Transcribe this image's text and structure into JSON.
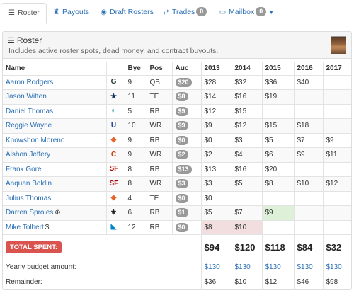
{
  "tabs": [
    {
      "label": "Roster",
      "icon": "list-icon"
    },
    {
      "label": "Payouts",
      "icon": "trophy-icon"
    },
    {
      "label": "Draft Rosters",
      "icon": "eye-icon"
    },
    {
      "label": "Trades",
      "icon": "exchange-icon",
      "badge": "0"
    },
    {
      "label": "Mailbox",
      "icon": "inbox-icon",
      "badge": "0"
    }
  ],
  "panel": {
    "title": "Roster",
    "subtitle": "Includes active roster spots, dead money, and contract buyouts."
  },
  "table": {
    "headers": [
      "Name",
      "",
      "Bye",
      "Pos",
      "Auc",
      "2013",
      "2014",
      "2015",
      "2016",
      "2017"
    ],
    "rows": [
      {
        "name": "Aaron Rodgers",
        "team": "GB",
        "bye": "9",
        "pos": "QB",
        "auc": "$20",
        "y2013": "$28",
        "y2014": "$32",
        "y2015": "$36",
        "y2016": "$40",
        "y2017": ""
      },
      {
        "name": "Jason Witten",
        "team": "DAL",
        "bye": "11",
        "pos": "TE",
        "auc": "$8",
        "y2013": "$14",
        "y2014": "$16",
        "y2015": "$19",
        "y2016": "",
        "y2017": ""
      },
      {
        "name": "Daniel Thomas",
        "team": "MIA",
        "bye": "5",
        "pos": "RB",
        "auc": "$9",
        "y2013": "$12",
        "y2014": "$15",
        "y2015": "",
        "y2016": "",
        "y2017": ""
      },
      {
        "name": "Reggie Wayne",
        "team": "IND",
        "bye": "10",
        "pos": "WR",
        "auc": "$9",
        "y2013": "$9",
        "y2014": "$12",
        "y2015": "$15",
        "y2016": "$18",
        "y2017": ""
      },
      {
        "name": "Knowshon Moreno",
        "team": "DEN",
        "bye": "9",
        "pos": "RB",
        "auc": "$0",
        "y2013": "$0",
        "y2014": "$3",
        "y2015": "$5",
        "y2016": "$7",
        "y2017": "$9"
      },
      {
        "name": "Alshon Jeffery",
        "team": "CHI",
        "bye": "9",
        "pos": "WR",
        "auc": "$2",
        "y2013": "$2",
        "y2014": "$4",
        "y2015": "$6",
        "y2016": "$9",
        "y2017": "$11"
      },
      {
        "name": "Frank Gore",
        "team": "SF",
        "bye": "8",
        "pos": "RB",
        "auc": "$13",
        "y2013": "$13",
        "y2014": "$16",
        "y2015": "$20",
        "y2016": "",
        "y2017": ""
      },
      {
        "name": "Anquan Boldin",
        "team": "SF",
        "bye": "8",
        "pos": "WR",
        "auc": "$3",
        "y2013": "$3",
        "y2014": "$5",
        "y2015": "$8",
        "y2016": "$10",
        "y2017": "$12"
      },
      {
        "name": "Julius Thomas",
        "team": "DEN",
        "bye": "4",
        "pos": "TE",
        "auc": "$0",
        "y2013": "$0",
        "y2014": "",
        "y2015": "",
        "y2016": "",
        "y2017": ""
      },
      {
        "name": "Darren Sproles",
        "team": "NO",
        "extra": "plus-circle-icon",
        "bye": "6",
        "pos": "RB",
        "auc": "$1",
        "y2013": "$5",
        "y2014": "$7",
        "y2015": "$9",
        "y2016": "",
        "y2017": "",
        "highlight2015": "green"
      },
      {
        "name": "Mike Tolbert",
        "team": "CAR",
        "extra": "dollar-icon",
        "bye": "12",
        "pos": "RB",
        "auc": "$0",
        "y2013": "$8",
        "y2014": "$10",
        "y2015": "",
        "y2016": "",
        "y2017": "",
        "highlight": "red"
      }
    ],
    "total_label": "TOTAL SPENT:",
    "totals": [
      "$94",
      "$120",
      "$118",
      "$84",
      "$32"
    ],
    "budget_label": "Yearly budget amount:",
    "budget": [
      "$130",
      "$130",
      "$130",
      "$130",
      "$130"
    ],
    "remainder_label": "Remainder:",
    "remainder": [
      "$36",
      "$10",
      "$12",
      "$46",
      "$98"
    ]
  },
  "colors": {
    "link": "#2a6fb5",
    "danger": "#d9534f",
    "dead": "#f2dede",
    "bonus": "#dff0d8"
  }
}
